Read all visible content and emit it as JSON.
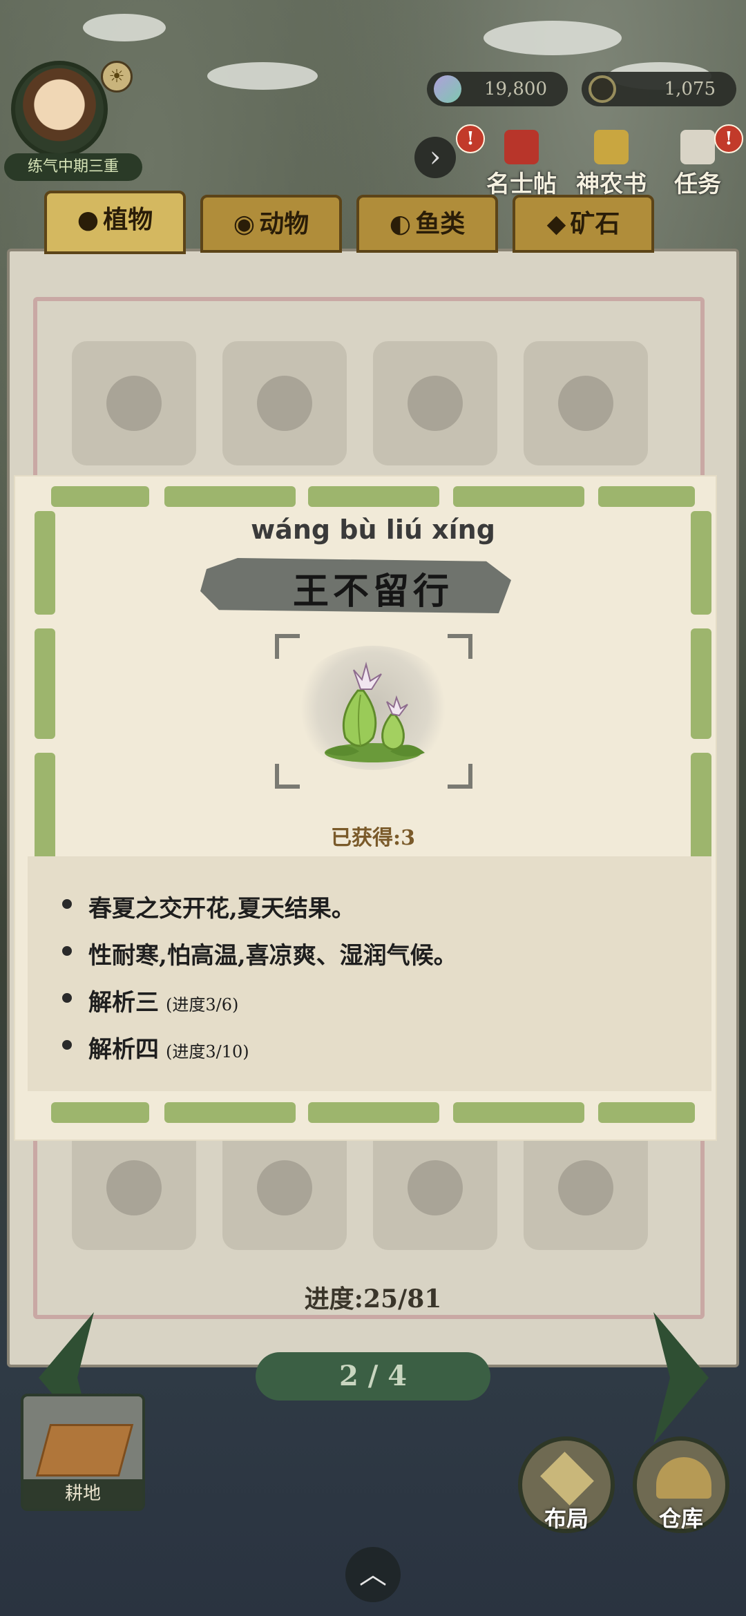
{
  "hud": {
    "rank": "练气中期三重",
    "jade": "19,800",
    "coins": "1,075",
    "buttons": [
      {
        "label": "名士帖"
      },
      {
        "label": "神农书"
      },
      {
        "label": "任务"
      }
    ]
  },
  "tabs": [
    {
      "label": "植物",
      "active": true
    },
    {
      "label": "动物",
      "active": false
    },
    {
      "label": "鱼类",
      "active": false
    },
    {
      "label": "矿石",
      "active": false
    }
  ],
  "modal": {
    "pinyin": "wáng bù liú xíng",
    "name": "王不留行",
    "obtained": "已获得:3",
    "lines": [
      {
        "text": "春夏之交开花,夏天结果。",
        "progress": ""
      },
      {
        "text": "性耐寒,怕高温,喜凉爽、湿润气候。",
        "progress": ""
      },
      {
        "text": "解析三",
        "progress": "(进度3/6)"
      },
      {
        "text": "解析四",
        "progress": "(进度3/10)"
      }
    ]
  },
  "book": {
    "progress": "进度:25/81",
    "page": "2 / 4"
  },
  "bottom": {
    "farm_label": "耕地",
    "layout_label": "布局",
    "storage_label": "仓库"
  }
}
